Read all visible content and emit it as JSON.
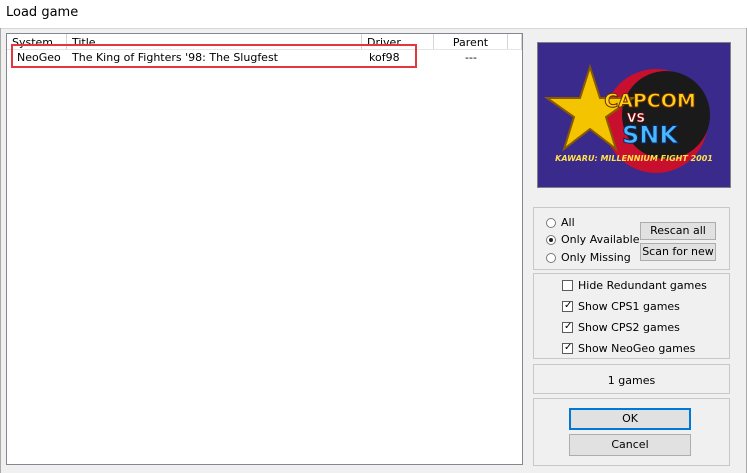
{
  "window": {
    "title": "Load game"
  },
  "table": {
    "columns": [
      "System",
      "Title",
      "Driver",
      "Parent"
    ],
    "rows": [
      {
        "system": "NeoGeo",
        "title": "The King of Fighters '98: The Slugfest",
        "driver": "kof98",
        "parent": "---"
      }
    ]
  },
  "preview": {
    "logo_top": "CAPCOM",
    "logo_vs": "VS",
    "logo_bottom": "SNK",
    "subtitle": "KAWARU: MILLENNIUM FIGHT 2001"
  },
  "filter": {
    "options": [
      "All",
      "Only Available",
      "Only Missing"
    ],
    "selected": "Only Available",
    "rescan_label": "Rescan all",
    "scan_new_label": "Scan for new"
  },
  "options": {
    "items": [
      {
        "label": "Hide Redundant games",
        "checked": false
      },
      {
        "label": "Show CPS1 games",
        "checked": true
      },
      {
        "label": "Show CPS2 games",
        "checked": true
      },
      {
        "label": "Show NeoGeo games",
        "checked": true
      }
    ]
  },
  "status": {
    "count_text": "1 games"
  },
  "buttons": {
    "ok": "OK",
    "cancel": "Cancel"
  },
  "colors": {
    "highlight": "#e2373c",
    "preview_bg": "#3a2a8c",
    "accent": "#0078d7"
  }
}
